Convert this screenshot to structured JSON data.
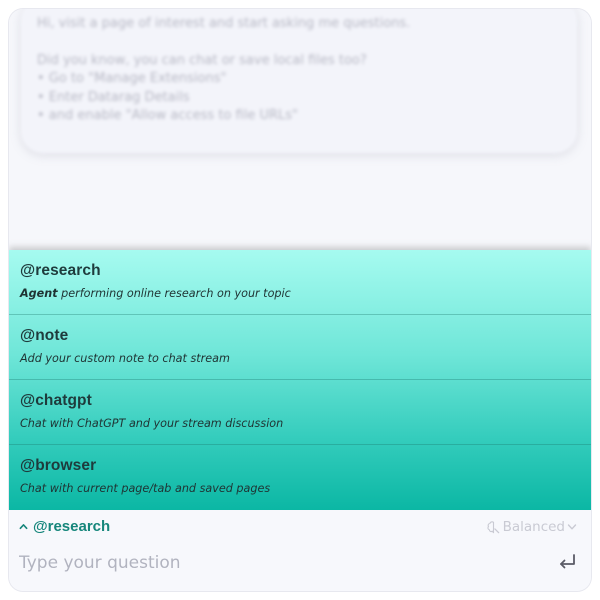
{
  "welcome": {
    "greeting": "Hi, visit a page of interest and start asking me questions.",
    "tip_title": "Did you know, you can chat or save local files too?",
    "tips": [
      "• Go to \"Manage Extensions\"",
      "• Enter Datarag Details",
      "• and enable \"Allow access to file URLs\""
    ]
  },
  "mentions": [
    {
      "name": "@research",
      "desc_bold": "Agent",
      "desc": " performing online research on your topic"
    },
    {
      "name": "@note",
      "desc_bold": "",
      "desc": "Add your custom note to chat stream"
    },
    {
      "name": "@chatgpt",
      "desc_bold": "",
      "desc": "Chat with ChatGPT and your stream discussion"
    },
    {
      "name": "@browser",
      "desc_bold": "",
      "desc": "Chat with current page/tab and saved pages"
    }
  ],
  "bottom": {
    "selected_mention": "@research",
    "mode_label": "Balanced",
    "input_placeholder": "Type your question",
    "input_value": ""
  },
  "icons": {
    "selected_toggle": "chevron-up-icon",
    "mode": "brain-icon",
    "mode_dropdown": "chevron-down-icon",
    "send": "enter-return-icon"
  },
  "colors": {
    "accent": "#16867b",
    "mentions_top": "#a6fbf0",
    "mentions_bottom": "#0bb7a4"
  }
}
